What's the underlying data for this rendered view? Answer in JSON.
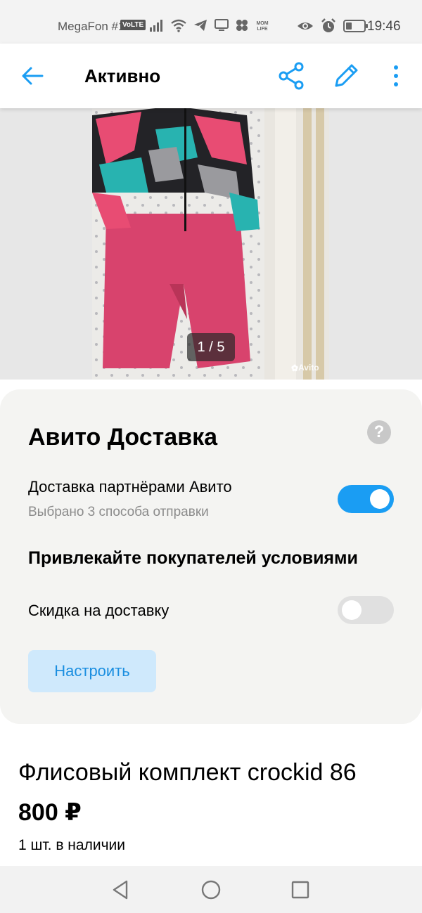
{
  "status_bar": {
    "carrier": "MegaFon #1",
    "volte": "VoLTE",
    "time": "19:46",
    "icons": [
      "signal-icon",
      "wifi-icon",
      "telegram-icon",
      "cast-icon",
      "paw-icon",
      "momlife-icon",
      "eye-icon",
      "alarm-icon",
      "battery-icon"
    ],
    "momlife": "MOM LIFE"
  },
  "app_bar": {
    "title": "Активно",
    "icons": [
      "back-arrow-icon",
      "share-icon",
      "edit-pencil-icon",
      "more-vertical-icon"
    ]
  },
  "gallery": {
    "counter": "1 / 5",
    "watermark": "Avito"
  },
  "delivery": {
    "title": "Авито Доставка",
    "help": "?",
    "partner_option": {
      "label": "Доставка партнёрами Авито",
      "sub": "Выбрано 3 способа отправки",
      "enabled": true
    },
    "section_title": "Привлекайте покупателей условиями",
    "discount_option": {
      "label": "Скидка на доставку",
      "enabled": false
    },
    "setup_button": "Настроить"
  },
  "listing": {
    "title": "Флисовый комплект crockid 86",
    "price": "800 ₽",
    "stock": "1 шт. в наличии"
  },
  "colors": {
    "accent": "#1a9df3",
    "button_bg": "#cfe9fc",
    "button_text": "#1a8ee0",
    "card_bg": "#f4f4f2"
  }
}
